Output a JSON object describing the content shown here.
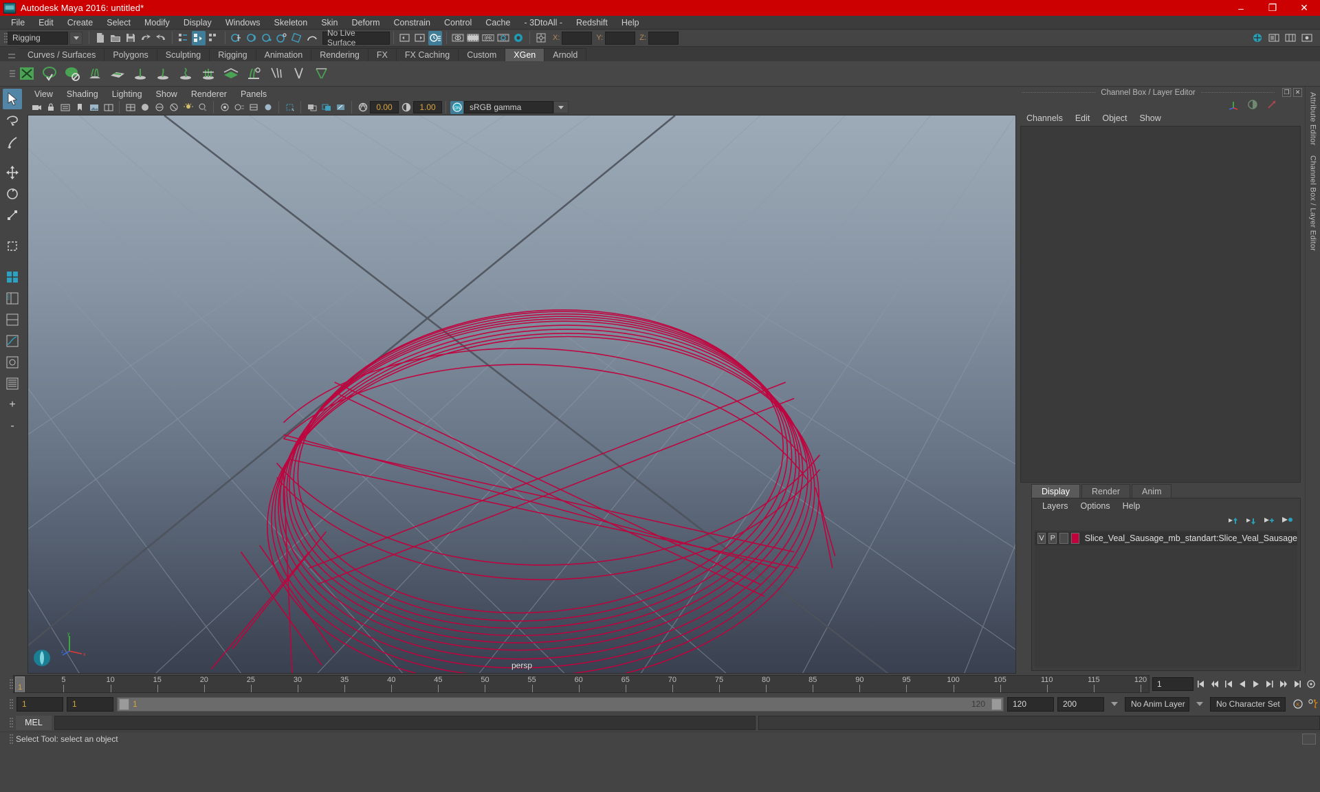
{
  "window": {
    "title": "Autodesk Maya 2016: untitled*",
    "minimize": "–",
    "maximize": "❐",
    "close": "✕"
  },
  "menubar": {
    "items": [
      "File",
      "Edit",
      "Create",
      "Select",
      "Modify",
      "Display",
      "Windows",
      "Skeleton",
      "Skin",
      "Deform",
      "Constrain",
      "Control",
      "Cache",
      "- 3DtoAll -",
      "Redshift",
      "Help"
    ]
  },
  "statusline": {
    "menu_set": "Rigging",
    "live_surface": "No Live Surface",
    "x_label": "X:",
    "y_label": "Y:",
    "z_label": "Z:",
    "x_value": "",
    "y_value": "",
    "z_value": "",
    "ipb_label": "IPR",
    "xs_label": "X:"
  },
  "shelf": {
    "tabs": [
      "Curves / Surfaces",
      "Polygons",
      "Sculpting",
      "Rigging",
      "Animation",
      "Rendering",
      "FX",
      "FX Caching",
      "Custom",
      "XGen",
      "Arnold"
    ],
    "active": "XGen"
  },
  "viewport": {
    "menus": [
      "View",
      "Shading",
      "Lighting",
      "Show",
      "Renderer",
      "Panels"
    ],
    "exposure": "0.00",
    "gamma": "1.00",
    "color_management": "sRGB gamma",
    "camera_label": "persp",
    "axis_x": "x",
    "axis_y": "y",
    "axis_z": "z"
  },
  "channelbox": {
    "panel_title": "Channel Box / Layer Editor",
    "menus": [
      "Channels",
      "Edit",
      "Object",
      "Show"
    ],
    "float_icon": "❐",
    "close_icon": "✕",
    "attribute_editor_label": "Attribute Editor",
    "channel_box_label": "Channel Box / Layer Editor"
  },
  "layereditor": {
    "tabs": [
      "Display",
      "Render",
      "Anim"
    ],
    "active_tab": "Display",
    "menus": [
      "Layers",
      "Options",
      "Help"
    ],
    "layers": [
      {
        "visibility": "V",
        "playback": "P",
        "shading": "",
        "color": "#c2003c",
        "name": "Slice_Veal_Sausage_mb_standart:Slice_Veal_Sausage"
      }
    ]
  },
  "timeslider": {
    "current_frame": "1",
    "ticks": [
      5,
      10,
      15,
      20,
      25,
      30,
      35,
      40,
      45,
      50,
      55,
      60,
      65,
      70,
      75,
      80,
      85,
      90,
      95,
      100,
      105,
      110,
      115,
      120
    ],
    "range_start": 1,
    "range_end": 120,
    "frame_field": "1"
  },
  "rangeslider": {
    "anim_start": "1",
    "playback_start": "1",
    "slider_low": "1",
    "slider_high": "120",
    "playback_end": "120",
    "anim_end": "200",
    "anim_layer": "No Anim Layer",
    "character_set": "No Character Set"
  },
  "commandline": {
    "language": "MEL",
    "input_value": "",
    "output_value": ""
  },
  "helpline": {
    "text": "Select Tool: select an object"
  },
  "colors": {
    "title_bar": "#cc0000",
    "accent_blue": "#5285a6",
    "panel_bg": "#444444",
    "wireframe": "#c2003c",
    "xgen_green": "#4aa352"
  }
}
